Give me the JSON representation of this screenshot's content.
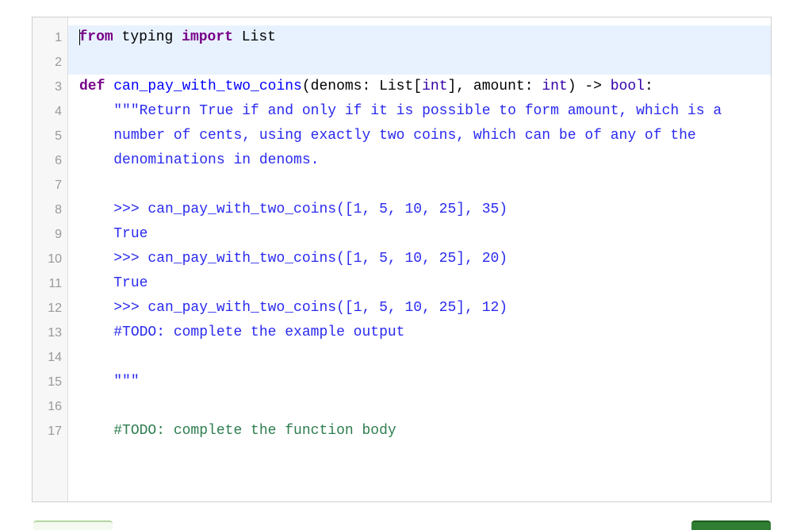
{
  "editor": {
    "language": "python",
    "active_lines": [
      1,
      2
    ],
    "lines": [
      {
        "n": "1",
        "tokens": [
          {
            "t": "from",
            "c": "kw"
          },
          {
            "t": " typing ",
            "c": ""
          },
          {
            "t": "import",
            "c": "kw"
          },
          {
            "t": " List",
            "c": ""
          }
        ]
      },
      {
        "n": "2",
        "tokens": []
      },
      {
        "n": "3",
        "tokens": [
          {
            "t": "def",
            "c": "kw"
          },
          {
            "t": " ",
            "c": ""
          },
          {
            "t": "can_pay_with_two_coins",
            "c": "def"
          },
          {
            "t": "(denoms: List[",
            "c": ""
          },
          {
            "t": "int",
            "c": "bi"
          },
          {
            "t": "], amount: ",
            "c": ""
          },
          {
            "t": "int",
            "c": "bi"
          },
          {
            "t": ") -> ",
            "c": ""
          },
          {
            "t": "bool",
            "c": "bi"
          },
          {
            "t": ":",
            "c": ""
          }
        ]
      },
      {
        "n": "4",
        "tokens": [
          {
            "t": "    \"\"\"Return True if and only if it is possible to form amount, which is a",
            "c": "str"
          }
        ]
      },
      {
        "n": "5",
        "tokens": [
          {
            "t": "    number of cents, using exactly two coins, which can be of any of the",
            "c": "str"
          }
        ]
      },
      {
        "n": "6",
        "tokens": [
          {
            "t": "    denominations in denoms.",
            "c": "str"
          }
        ]
      },
      {
        "n": "7",
        "tokens": []
      },
      {
        "n": "8",
        "tokens": [
          {
            "t": "    >>> can_pay_with_two_coins([1, 5, 10, 25], 35)",
            "c": "str"
          }
        ]
      },
      {
        "n": "9",
        "tokens": [
          {
            "t": "    True",
            "c": "str"
          }
        ]
      },
      {
        "n": "10",
        "tokens": [
          {
            "t": "    >>> can_pay_with_two_coins([1, 5, 10, 25], 20)",
            "c": "str"
          }
        ]
      },
      {
        "n": "11",
        "tokens": [
          {
            "t": "    True",
            "c": "str"
          }
        ]
      },
      {
        "n": "12",
        "tokens": [
          {
            "t": "    >>> can_pay_with_two_coins([1, 5, 10, 25], 12)",
            "c": "str"
          }
        ]
      },
      {
        "n": "13",
        "tokens": [
          {
            "t": "    #TODO: complete the example output",
            "c": "str"
          }
        ]
      },
      {
        "n": "14",
        "tokens": []
      },
      {
        "n": "15",
        "tokens": [
          {
            "t": "    \"\"\"",
            "c": "str"
          }
        ]
      },
      {
        "n": "16",
        "tokens": []
      },
      {
        "n": "17",
        "tokens": [
          {
            "t": "    #TODO: complete the function body",
            "c": "com"
          }
        ]
      }
    ]
  },
  "colors": {
    "keyword": "#770088",
    "def_name": "#0000ff",
    "builtin": "#3300aa",
    "string": "#2a2af0",
    "comment": "#2e7d4f",
    "active_line_bg": "#e8f2ff"
  }
}
